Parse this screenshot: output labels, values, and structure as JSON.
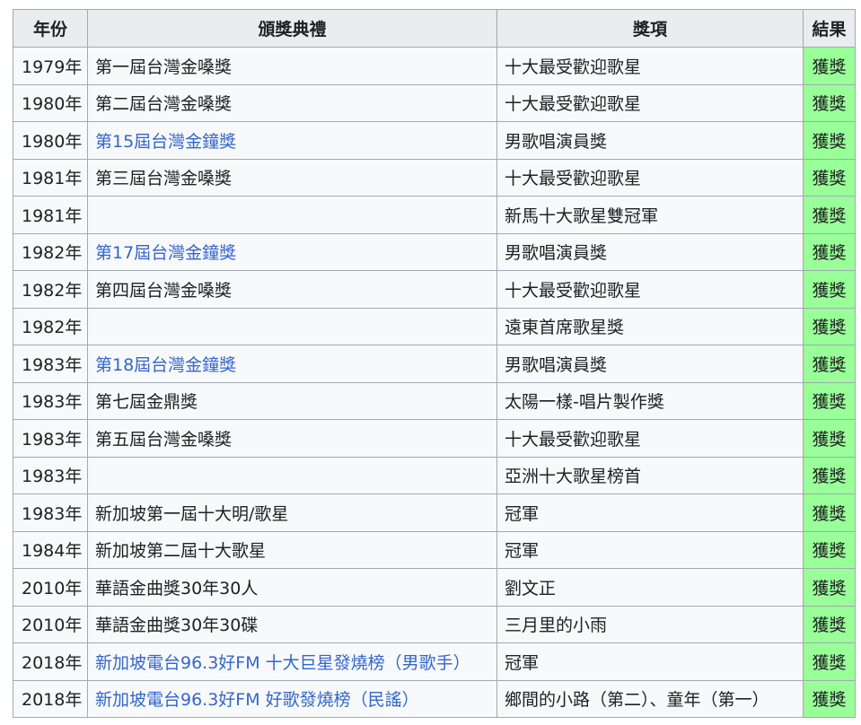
{
  "table": {
    "headers": {
      "year": "年份",
      "ceremony": "頒獎典禮",
      "award": "獎項",
      "result": "結果"
    },
    "rows": [
      {
        "year": "1979年",
        "ceremony": "第一屆台灣金嗓獎",
        "ceremony_is_link": false,
        "award": "十大最受歡迎歌星",
        "result": "獲獎"
      },
      {
        "year": "1980年",
        "ceremony": "第二屆台灣金嗓獎",
        "ceremony_is_link": false,
        "award": "十大最受歡迎歌星",
        "result": "獲獎"
      },
      {
        "year": "1980年",
        "ceremony": "第15屆台灣金鐘獎",
        "ceremony_is_link": true,
        "award": "男歌唱演員獎",
        "result": "獲獎"
      },
      {
        "year": "1981年",
        "ceremony": "第三屆台灣金嗓獎",
        "ceremony_is_link": false,
        "award": "十大最受歡迎歌星",
        "result": "獲獎"
      },
      {
        "year": "1981年",
        "ceremony": "",
        "ceremony_is_link": false,
        "award": "新馬十大歌星雙冠軍",
        "result": "獲獎"
      },
      {
        "year": "1982年",
        "ceremony": "第17屆台灣金鐘獎",
        "ceremony_is_link": true,
        "award": "男歌唱演員獎",
        "result": "獲獎"
      },
      {
        "year": "1982年",
        "ceremony": "第四屆台灣金嗓獎",
        "ceremony_is_link": false,
        "award": "十大最受歡迎歌星",
        "result": "獲獎"
      },
      {
        "year": "1982年",
        "ceremony": "",
        "ceremony_is_link": false,
        "award": "遠東首席歌星獎",
        "result": "獲獎"
      },
      {
        "year": "1983年",
        "ceremony": "第18屆台灣金鐘獎",
        "ceremony_is_link": true,
        "award": "男歌唱演員獎",
        "result": "獲獎"
      },
      {
        "year": "1983年",
        "ceremony": "第七屆金鼎獎",
        "ceremony_is_link": false,
        "award": "太陽一樣-唱片製作獎",
        "result": "獲獎"
      },
      {
        "year": "1983年",
        "ceremony": "第五屆台灣金嗓獎",
        "ceremony_is_link": false,
        "award": "十大最受歡迎歌星",
        "result": "獲獎"
      },
      {
        "year": "1983年",
        "ceremony": "",
        "ceremony_is_link": false,
        "award": "亞洲十大歌星榜首",
        "result": "獲獎"
      },
      {
        "year": "1983年",
        "ceremony": "新加坡第一屆十大明/歌星",
        "ceremony_is_link": false,
        "award": "冠軍",
        "result": "獲獎"
      },
      {
        "year": "1984年",
        "ceremony": "新加坡第二屆十大歌星",
        "ceremony_is_link": false,
        "award": "冠軍",
        "result": "獲獎"
      },
      {
        "year": "2010年",
        "ceremony": "華語金曲獎30年30人",
        "ceremony_is_link": false,
        "award": "劉文正",
        "result": "獲獎"
      },
      {
        "year": "2010年",
        "ceremony": "華語金曲獎30年30碟",
        "ceremony_is_link": false,
        "award": "三月里的小雨",
        "result": "獲獎"
      },
      {
        "year": "2018年",
        "ceremony": "新加坡電台96.3好FM 十大巨星發燒榜（男歌手）",
        "ceremony_is_link": true,
        "award": "冠軍",
        "result": "獲獎"
      },
      {
        "year": "2018年",
        "ceremony": "新加坡電台96.3好FM 好歌發燒榜（民謠）",
        "ceremony_is_link": true,
        "award": "鄉間的小路（第二）、童年（第一）",
        "result": "獲獎"
      }
    ]
  },
  "colors": {
    "link": "#3366cc",
    "won_background": "#99ff99",
    "header_background": "#eaecf0",
    "cell_background": "#f8f9fa",
    "border": "#a2a9b1"
  }
}
